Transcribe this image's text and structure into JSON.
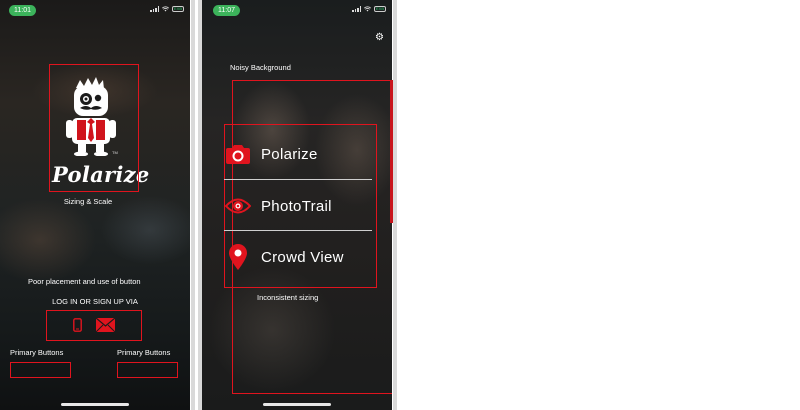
{
  "phone1": {
    "time": "11:01",
    "battery": "EXB",
    "logo_text": "Polarize",
    "trademark": "TM",
    "subtitle": "Sizing & Scale",
    "annotation_button": "Poor placement and use of button",
    "login_text": "LOG IN OR SIGN UP VIA",
    "login_icons": [
      "phone-icon",
      "mail-icon"
    ],
    "primary_left_label": "Primary Buttons",
    "primary_right_label": "Primary Buttons"
  },
  "phone2": {
    "time": "11:07",
    "battery": "EXB",
    "annotation_background": "Noisy Background",
    "menu": [
      {
        "label": "Polarize",
        "icon": "camera-icon"
      },
      {
        "label": "PhotoTrail",
        "icon": "eye-icon"
      },
      {
        "label": "Crowd View",
        "icon": "map-pin-icon"
      }
    ],
    "annotation_sizing": "Inconsistent sizing"
  },
  "colors": {
    "accent_red": "#e0141e",
    "status_green": "#3cb35b",
    "text_white": "#ffffff"
  }
}
